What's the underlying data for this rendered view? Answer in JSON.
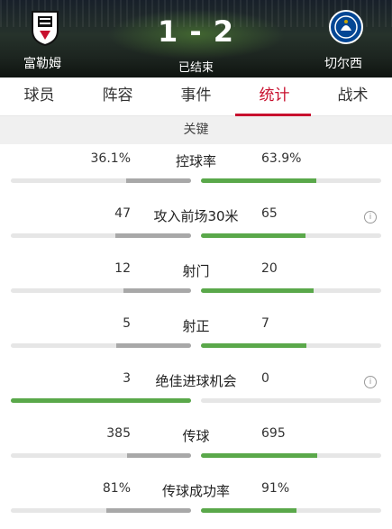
{
  "match": {
    "home_team": "富勒姆",
    "away_team": "切尔西",
    "score": "1 - 2",
    "status": "已结束"
  },
  "tabs": [
    {
      "label": "球员"
    },
    {
      "label": "阵容"
    },
    {
      "label": "事件"
    },
    {
      "label": "统计",
      "active": true
    },
    {
      "label": "战术"
    }
  ],
  "section_title": "关键",
  "colors": {
    "accent": "#c8102e",
    "winner_bar": "#5aa84a",
    "loser_bar": "#a8a8a8",
    "track": "#e6e6e6"
  },
  "stats": [
    {
      "label": "控球率",
      "home": "36.1%",
      "away": "63.9%",
      "home_frac": 0.361,
      "away_frac": 0.639,
      "info": false
    },
    {
      "label": "攻入前场30米",
      "home": "47",
      "away": "65",
      "home_frac": 0.42,
      "away_frac": 0.58,
      "info": true
    },
    {
      "label": "射门",
      "home": "12",
      "away": "20",
      "home_frac": 0.375,
      "away_frac": 0.625,
      "info": false
    },
    {
      "label": "射正",
      "home": "5",
      "away": "7",
      "home_frac": 0.417,
      "away_frac": 0.583,
      "info": false
    },
    {
      "label": "绝佳进球机会",
      "home": "3",
      "away": "0",
      "home_frac": 1.0,
      "away_frac": 0.0,
      "info": true
    },
    {
      "label": "传球",
      "home": "385",
      "away": "695",
      "home_frac": 0.356,
      "away_frac": 0.644,
      "info": false
    },
    {
      "label": "传球成功率",
      "home": "81%",
      "away": "91%",
      "home_frac": 0.47,
      "away_frac": 0.53,
      "info": false
    }
  ]
}
